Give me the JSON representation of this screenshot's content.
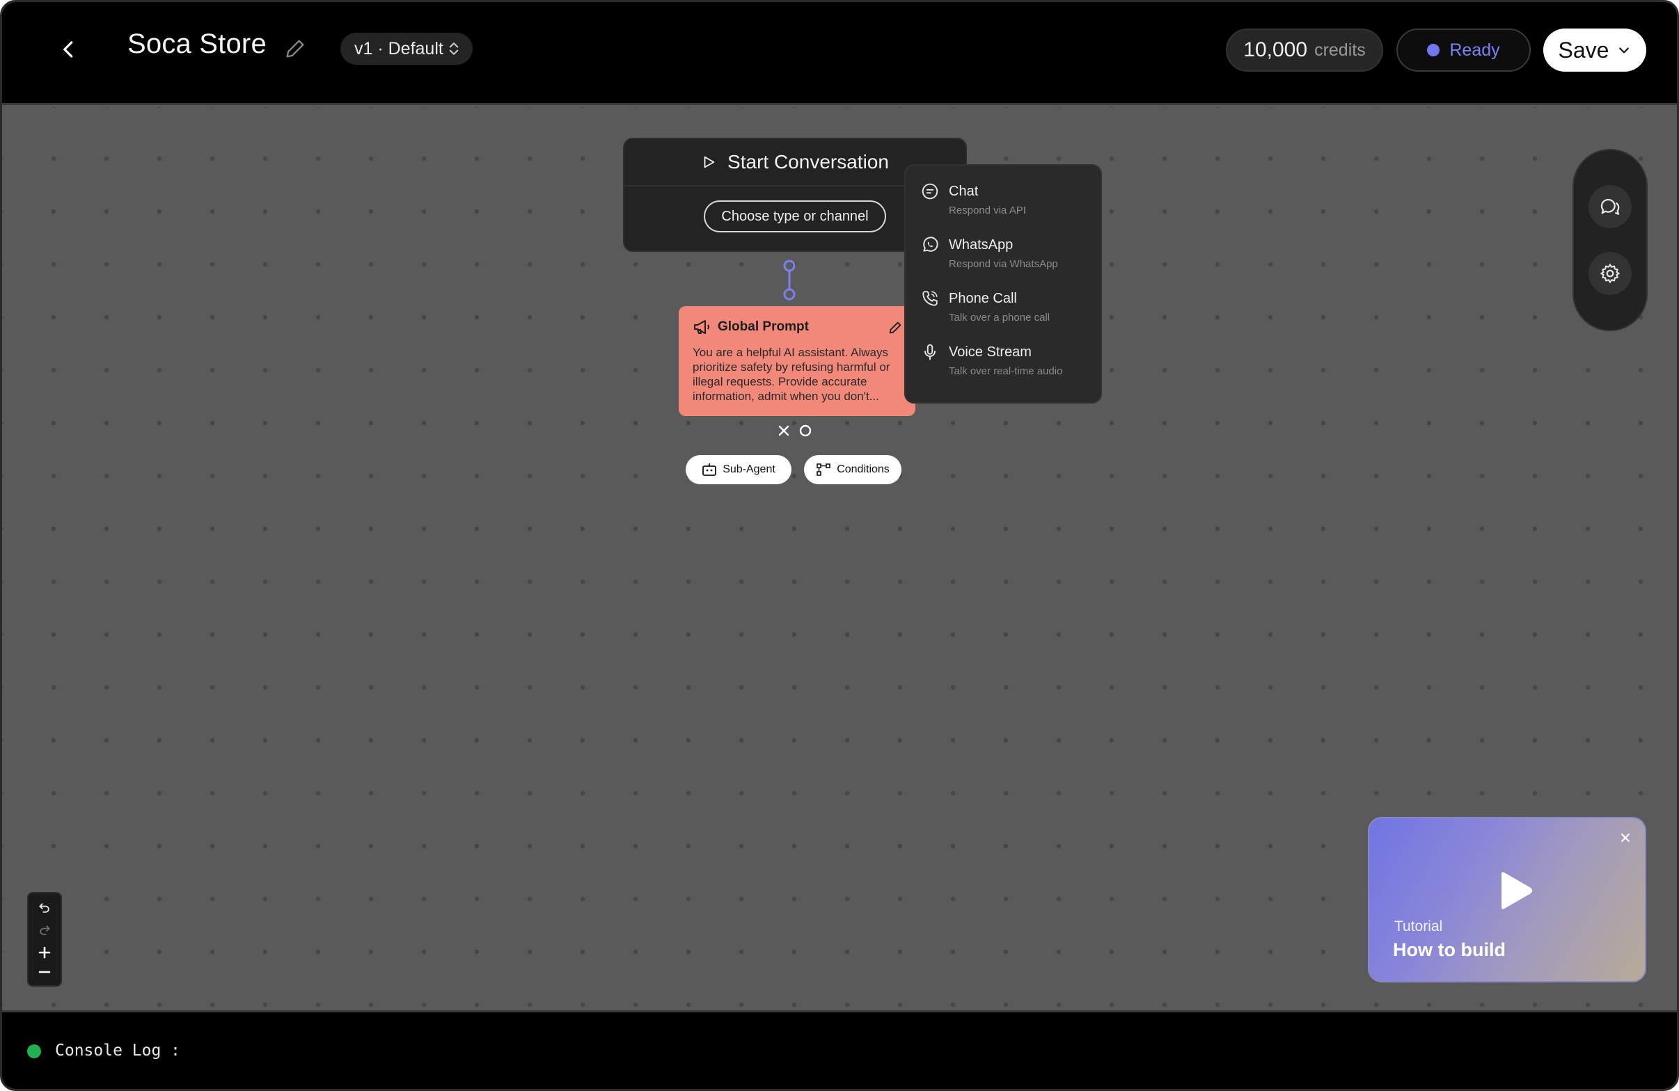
{
  "header": {
    "title": "Soca Store",
    "version_label": "v1 · Default",
    "credits_amount": "10,000",
    "credits_unit": "credits",
    "status_label": "Ready",
    "save_label": "Save"
  },
  "start_node": {
    "title": "Start Conversation",
    "channel_button_label": "Choose type or channel"
  },
  "channel_menu": {
    "items": [
      {
        "label": "Chat",
        "description": "Respond via API",
        "icon": "chat-icon"
      },
      {
        "label": "WhatsApp",
        "description": "Respond via WhatsApp",
        "icon": "whatsapp-icon"
      },
      {
        "label": "Phone Call",
        "description": "Talk over a phone call",
        "icon": "phone-icon"
      },
      {
        "label": "Voice Stream",
        "description": "Talk over real-time audio",
        "icon": "microphone-icon"
      }
    ]
  },
  "prompt_node": {
    "title": "Global Prompt",
    "text": "You are a helpful AI assistant. Always prioritize safety by refusing harmful or illegal requests. Provide accurate information, admit when you don't..."
  },
  "node_actions": {
    "subagent_label": "Sub-Agent",
    "conditions_label": "Conditions"
  },
  "tutorial": {
    "label": "Tutorial",
    "title": "How to build"
  },
  "console": {
    "label": "Console Log :"
  },
  "colors": {
    "accent": "#6f78f0",
    "prompt_node": "#f1887a",
    "console_ok": "#1fb04f"
  }
}
